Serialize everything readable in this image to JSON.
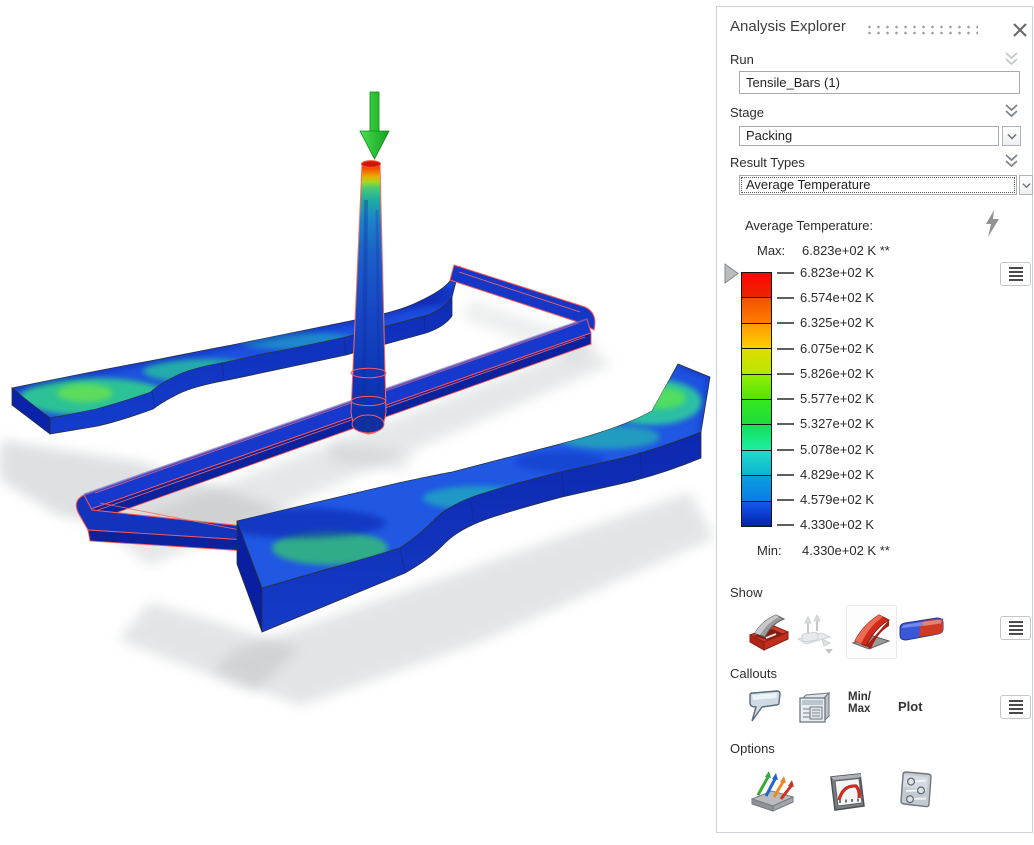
{
  "panel": {
    "title": "Analysis Explorer",
    "run": {
      "label": "Run",
      "value": "Tensile_Bars (1)"
    },
    "stage": {
      "label": "Stage",
      "value": "Packing"
    },
    "result_types": {
      "label": "Result Types",
      "value": "Average Temperature"
    },
    "legend": {
      "title": "Average Temperature:",
      "max_label": "Max:",
      "max_value": "6.823e+02 K **",
      "min_label": "Min:",
      "min_value": "4.330e+02 K **",
      "ticks": [
        "6.823e+02 K",
        "6.574e+02 K",
        "6.325e+02 K",
        "6.075e+02 K",
        "5.826e+02 K",
        "5.577e+02 K",
        "5.327e+02 K",
        "5.078e+02 K",
        "4.829e+02 K",
        "4.579e+02 K",
        "4.330e+02 K"
      ],
      "band_styles": [
        "background:linear-gradient(180deg,#ff0600,#ea2500)",
        "background:linear-gradient(180deg,#f25000,#ff7e00)",
        "background:linear-gradient(180deg,#ff9a00,#ffcf00)",
        "background:linear-gradient(180deg,#e0dc00,#b5e800)",
        "background:linear-gradient(180deg,#93ee00,#52e30c)",
        "background:linear-gradient(180deg,#36e81e,#1edd3c)",
        "background:linear-gradient(180deg,#14e158,#1ceda2)",
        "background:linear-gradient(180deg,#1fdcc8,#0eb2d2)",
        "background:linear-gradient(180deg,#0ba0de,#0b7ce4)",
        "background:linear-gradient(180deg,#145af0,#0522ac)"
      ]
    },
    "show": {
      "label": "Show"
    },
    "callouts": {
      "label": "Callouts",
      "minmax_line1": "Min/",
      "minmax_line2": "Max",
      "plot_label": "Plot"
    },
    "options": {
      "label": "Options"
    }
  },
  "viewport": {
    "injection_arrow_color": "#22c32c",
    "wireframe_color": "#ff5858"
  }
}
